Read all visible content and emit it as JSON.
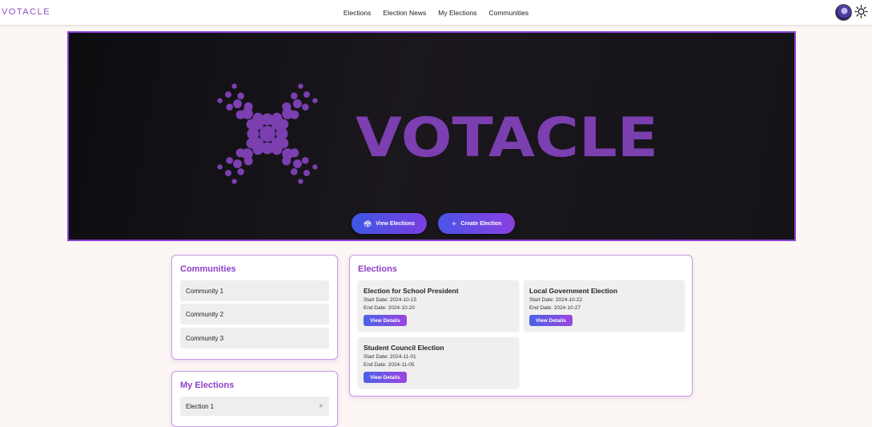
{
  "header": {
    "brand": "VOTACLE",
    "nav": [
      "Elections",
      "Election News",
      "My Elections",
      "Communities"
    ],
    "avatar_icon": "user-avatar",
    "theme_toggle_icon": "sun-icon"
  },
  "hero": {
    "logo_text": "VOTACLE",
    "view_elections_label": "View Elections",
    "view_elections_icon": "ballot-box-icon",
    "create_election_label": "Create Election",
    "create_election_icon": "sparkle-icon",
    "accent_color": "#8b42d6"
  },
  "communities": {
    "title": "Communities",
    "items": [
      "Community 1",
      "Community 2",
      "Community 3"
    ]
  },
  "my_elections": {
    "title": "My Elections",
    "items": [
      {
        "label": "Election 1",
        "chevron": ">"
      }
    ]
  },
  "elections": {
    "title": "Elections",
    "items": [
      {
        "title": "Election for School President",
        "start": "Start Date: 2024-10-15",
        "end": "End Date: 2024-10-20",
        "button": "View Details"
      },
      {
        "title": "Local Government Election",
        "start": "Start Date: 2024-10-22",
        "end": "End Date: 2024-10-27",
        "button": "View Details"
      },
      {
        "title": "Student Council Election",
        "start": "Start Date: 2024-11-01",
        "end": "End Date: 2024-11-05",
        "button": "View Details"
      }
    ]
  }
}
